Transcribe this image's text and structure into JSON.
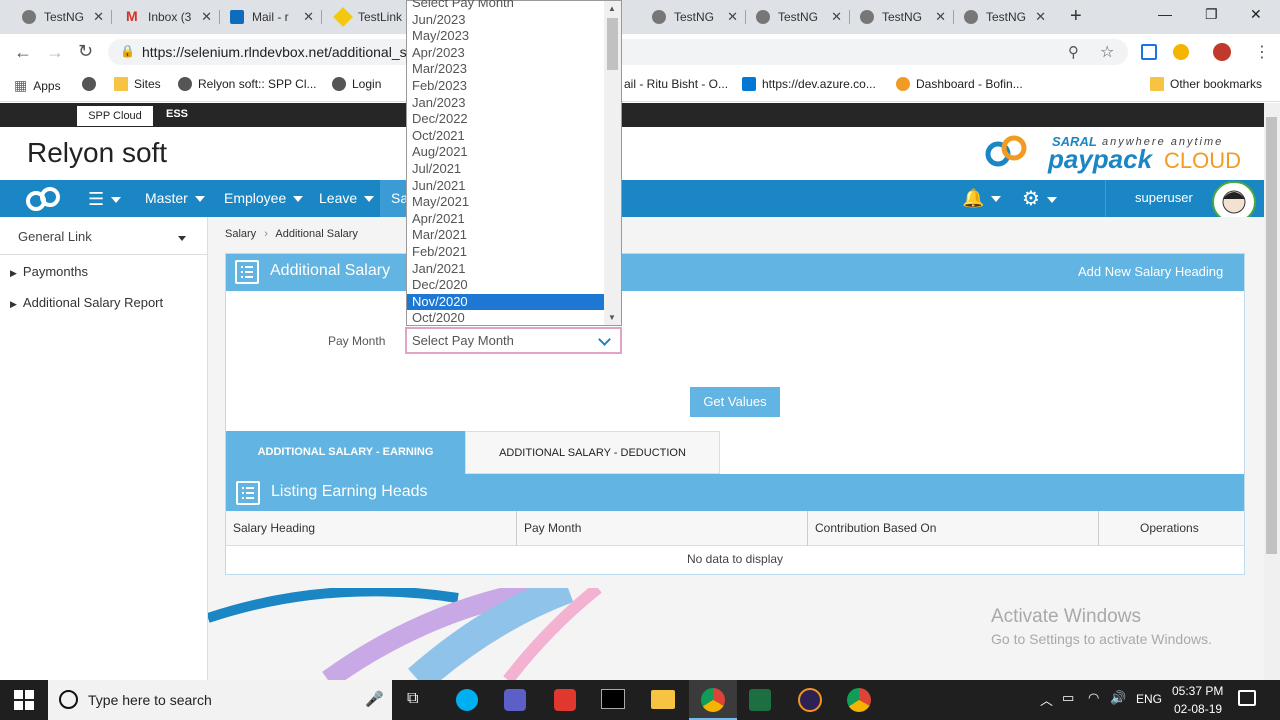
{
  "tabs": [
    {
      "title": "TestNG",
      "icon": "globe-icon"
    },
    {
      "title": "Inbox (3",
      "icon": "gmail-icon"
    },
    {
      "title": "Mail - r",
      "icon": "outlook-icon"
    },
    {
      "title": "TestLink",
      "icon": "testlink-icon"
    },
    {
      "title": "TestNG",
      "icon": "globe-icon"
    },
    {
      "title": "TestNG",
      "icon": "globe-icon"
    },
    {
      "title": "TestNG",
      "icon": "globe-icon"
    },
    {
      "title": "TestNG",
      "icon": "globe-icon"
    }
  ],
  "address": {
    "url": "https://selenium.rlndevbox.net/additional_s"
  },
  "bookmarks": [
    "Apps",
    "Sites",
    "Relyon soft:: SPP Cl...",
    "Login",
    "ail - Ritu Bisht - O...",
    "https://dev.azure.co...",
    "Dashboard - Bofin...",
    "Other bookmarks"
  ],
  "topbar": {
    "tab_active": "SPP Cloud",
    "tab_other": "ESS"
  },
  "brand": {
    "name": "Relyon soft",
    "logo_top": "SARAL",
    "logo_tag": "anywhere anytime",
    "logo_main": "paypack",
    "logo_cloud": "CLOUD"
  },
  "nav": {
    "items": [
      "Master",
      "Employee",
      "Leave",
      "Sal"
    ],
    "user": "superuser"
  },
  "sidebar": {
    "header": "General Link",
    "items": [
      "Paymonths",
      "Additional Salary Report"
    ]
  },
  "breadcrumb": {
    "root": "Salary",
    "current": "Additional Salary"
  },
  "panel": {
    "title": "Additional Salary",
    "add_link": "Add New Salary Heading",
    "pay_month_label": "Pay Month",
    "pay_month_value": "Select Pay Month",
    "get_values": "Get Values",
    "tab_earning": "ADDITIONAL SALARY - EARNING",
    "tab_deduction": "ADDITIONAL SALARY - DEDUCTION",
    "listing_title": "Listing Earning Heads",
    "columns": [
      "Salary Heading",
      "Pay Month",
      "Contribution Based On",
      "Operations"
    ],
    "empty": "No data to display"
  },
  "dropdown": {
    "options": [
      "Select Pay Month",
      "Jun/2023",
      "May/2023",
      "Apr/2023",
      "Mar/2023",
      "Feb/2023",
      "Jan/2023",
      "Dec/2022",
      "Oct/2021",
      "Aug/2021",
      "Jul/2021",
      "Jun/2021",
      "May/2021",
      "Apr/2021",
      "Mar/2021",
      "Feb/2021",
      "Jan/2021",
      "Dec/2020",
      "Nov/2020",
      "Oct/2020"
    ],
    "selected": "Nov/2020"
  },
  "watermark": {
    "line1": "Activate Windows",
    "line2": "Go to Settings to activate Windows."
  },
  "taskbar": {
    "search": "Type here to search",
    "lang": "ENG",
    "time": "05:37 PM",
    "date": "02-08-19"
  },
  "colors": {
    "nav": "#1a86c4",
    "panel_header": "#62b4e2",
    "selected": "#1e77d3"
  }
}
